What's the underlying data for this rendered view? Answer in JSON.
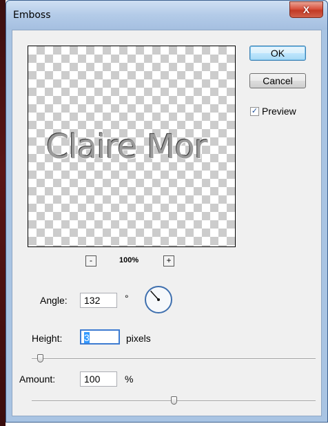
{
  "window": {
    "title": "Emboss",
    "close_glyph": "X"
  },
  "preview": {
    "sample_text": "Claire Mor"
  },
  "zoom": {
    "minus": "-",
    "level": "100%",
    "plus": "+"
  },
  "buttons": {
    "ok": "OK",
    "cancel": "Cancel"
  },
  "preview_toggle": {
    "label": "Preview",
    "checked": true,
    "check_glyph": "✓"
  },
  "angle": {
    "label": "Angle:",
    "value": "132",
    "unit": "°"
  },
  "height": {
    "label": "Height:",
    "value": "3",
    "unit": "pixels",
    "slider_fraction": 0.02
  },
  "amount": {
    "label": "Amount:",
    "value": "100",
    "unit": "%",
    "slider_fraction": 0.5
  },
  "colors": {
    "title_bg": "#b3cbe8",
    "client_bg": "#f0f0f0",
    "accent": "#3d7bd1",
    "close": "#c23a25"
  }
}
